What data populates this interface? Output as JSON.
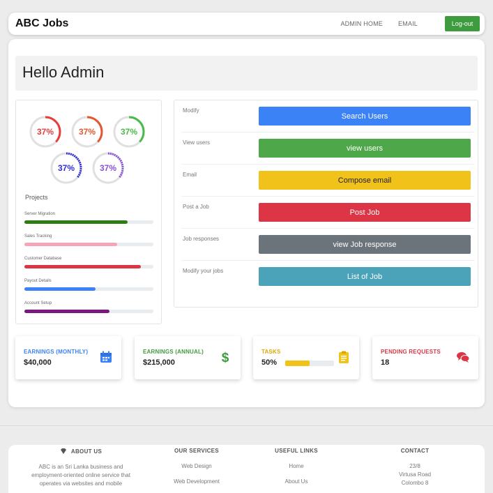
{
  "header": {
    "brand": "ABC Jobs",
    "nav": [
      "ADMIN HOME",
      "EMAIL"
    ],
    "logout_label": "Log-out"
  },
  "greeting": "Hello Admin",
  "rings": [
    {
      "value": "37%",
      "color": "#e53e3e"
    },
    {
      "value": "37%",
      "color": "#e4572e"
    },
    {
      "value": "37%",
      "color": "#48bb48"
    },
    {
      "value": "37%",
      "color": "#2d2de0"
    },
    {
      "value": "37%",
      "color": "#8a4fd8"
    }
  ],
  "projects": {
    "title": "Projects",
    "items": [
      {
        "label": "Server Migration",
        "value": 80,
        "color": "#2f7d12"
      },
      {
        "label": "Sales Tracking",
        "value": 72,
        "color": "#f4a6b8"
      },
      {
        "label": "Customer Database",
        "value": 90,
        "color": "#dc3545"
      },
      {
        "label": "Payout Details",
        "value": 55,
        "color": "#3b82f6"
      },
      {
        "label": "Account Setup",
        "value": 66,
        "color": "#7b1580"
      }
    ]
  },
  "actions": [
    {
      "label": "Modify",
      "button": "Search Users",
      "color": "#3b82f6",
      "text": "#ffffff"
    },
    {
      "label": "View users",
      "button": "view users",
      "color": "#4ea84a",
      "text": "#ffffff"
    },
    {
      "label": "Email",
      "button": "Compose email",
      "color": "#f1c21a",
      "text": "#222222"
    },
    {
      "label": "Post a Job",
      "button": "Post Job",
      "color": "#dc3545",
      "text": "#ffffff"
    },
    {
      "label": "Job responses",
      "button": "view Job response",
      "color": "#6b737b",
      "text": "#ffffff"
    },
    {
      "label": "Modify your jobs",
      "button": "List of Job",
      "color": "#4aa3b8",
      "text": "#ffffff"
    }
  ],
  "stats": [
    {
      "label": "EARNINGS (MONTHLY)",
      "value": "$40,000",
      "color": "#3b82f6",
      "icon": "calendar-icon"
    },
    {
      "label": "EARNINGS (ANNUAL)",
      "value": "$215,000",
      "color": "#3e9b3e",
      "icon": "dollar-icon"
    },
    {
      "label": "TASKS",
      "value": "50%",
      "progress": 50,
      "color": "#e0a800",
      "icon": "clipboard-icon"
    },
    {
      "label": "PENDING REQUESTS",
      "value": "18",
      "color": "#dc3545",
      "icon": "comments-icon"
    }
  ],
  "footer": {
    "about": {
      "title": "ABOUT US",
      "text": "ABC is an Sri Lanka business and employment-oriented online service that operates via websites and mobile"
    },
    "services": {
      "title": "OUR SERVICES",
      "items": [
        "Web Design",
        "Web Development"
      ]
    },
    "links": {
      "title": "USEFUL LINKS",
      "items": [
        "Home",
        "About Us"
      ]
    },
    "contact": {
      "title": "CONTACT",
      "items": [
        "23/8",
        "Virtusa Road",
        "Colombo 8"
      ]
    }
  }
}
